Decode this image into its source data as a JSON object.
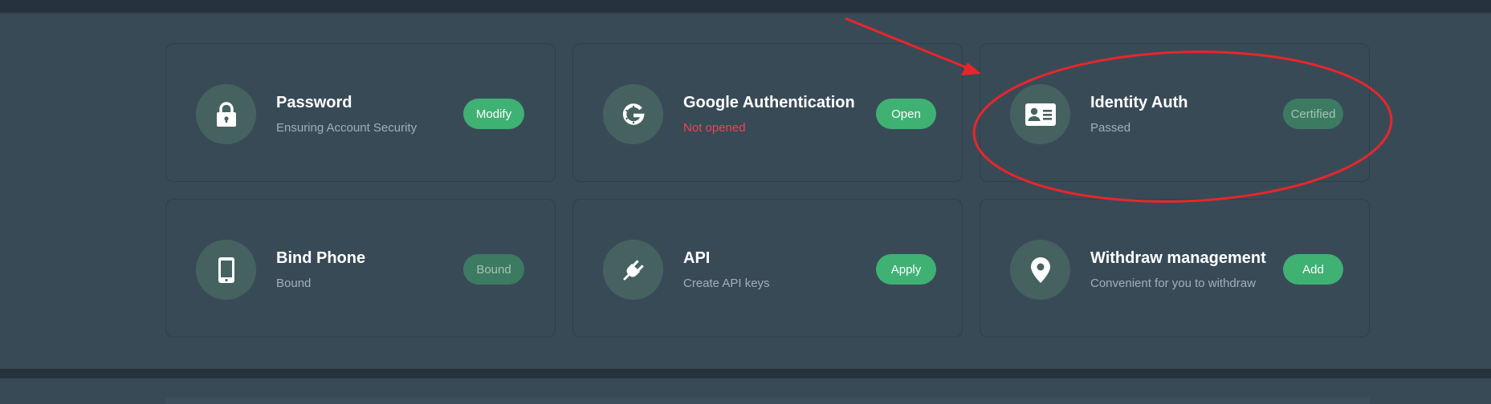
{
  "cards": [
    {
      "title": "Password",
      "subtitle": "Ensuring Account Security",
      "subtitle_style": "normal",
      "button": "Modify",
      "button_state": "active",
      "icon": "lock-icon"
    },
    {
      "title": "Google Authentication",
      "subtitle": "Not opened",
      "subtitle_style": "warning",
      "button": "Open",
      "button_state": "active",
      "icon": "google-icon"
    },
    {
      "title": "Identity Auth",
      "subtitle": "Passed",
      "subtitle_style": "normal",
      "button": "Certified",
      "button_state": "disabled",
      "icon": "id-card-icon"
    },
    {
      "title": "Bind Phone",
      "subtitle": "Bound",
      "subtitle_style": "normal",
      "button": "Bound",
      "button_state": "disabled",
      "icon": "phone-icon"
    },
    {
      "title": "API",
      "subtitle": "Create API keys",
      "subtitle_style": "normal",
      "button": "Apply",
      "button_state": "active",
      "icon": "plug-icon"
    },
    {
      "title": "Withdraw management",
      "subtitle": "Convenient for you to withdraw",
      "subtitle_style": "normal",
      "button": "Add",
      "button_state": "active",
      "icon": "location-pin-icon"
    }
  ],
  "colors": {
    "background": "#394a57",
    "icon_circle": "#456261",
    "button_active": "#3eb173",
    "button_disabled": "#3c7a62",
    "warning_text": "#f0424f",
    "annotation": "#e8262a"
  }
}
